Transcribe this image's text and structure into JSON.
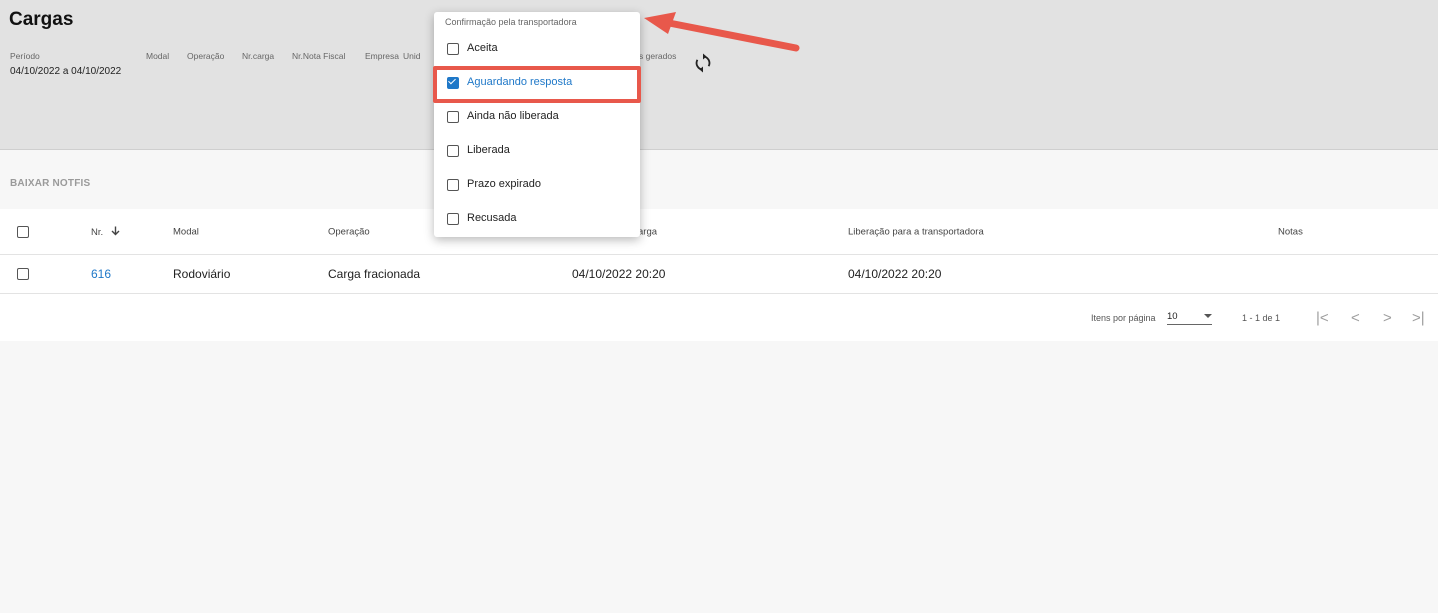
{
  "page": {
    "title": "Cargas"
  },
  "filters": {
    "labels": {
      "periodo": "Período",
      "modal": "Modal",
      "operacao": "Operação",
      "nr_carga": "Nr.carga",
      "nr_nota_fiscal": "Nr.Nota Fiscal",
      "empresa": "Empresa",
      "unidade_partial": "Unid",
      "gerados_partial": "s gerados"
    },
    "periodo_value": "04/10/2022 a 04/10/2022",
    "refresh_icon": "refresh-icon"
  },
  "toolbar": {
    "download_label": "BAIXAR NOTFIS"
  },
  "table": {
    "headers": {
      "nr": "Nr.",
      "modal": "Modal",
      "operacao": "Operação",
      "carga_partial": "arga",
      "liberacao": "Liberação para a transportadora",
      "notas": "Notas"
    },
    "sort_icon": "arrow-down-icon",
    "rows": [
      {
        "nr": "616",
        "modal": "Rodoviário",
        "operacao": "Carga fracionada",
        "data_carga": "04/10/2022 20:20",
        "liberacao": "04/10/2022 20:20",
        "notas": ""
      }
    ]
  },
  "paginator": {
    "items_label": "Itens por página",
    "page_size": "10",
    "range_label": "1 - 1 de 1"
  },
  "dropdown": {
    "title": "Confirmação pela transportadora",
    "options": [
      {
        "label": "Aceita",
        "checked": false
      },
      {
        "label": "Aguardando resposta",
        "checked": true
      },
      {
        "label": "Ainda não liberada",
        "checked": false
      },
      {
        "label": "Liberada",
        "checked": false
      },
      {
        "label": "Prazo expirado",
        "checked": false
      },
      {
        "label": "Recusada",
        "checked": false
      }
    ]
  },
  "colors": {
    "accent": "#1f78c8",
    "annotation": "#e8584b",
    "header_bg": "#e2e2e2"
  }
}
